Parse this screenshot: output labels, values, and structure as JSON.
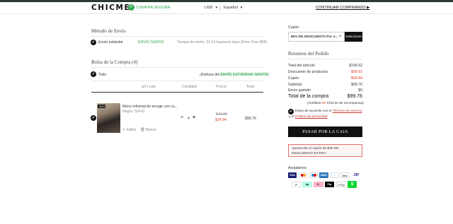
{
  "header": {
    "logo": "CHICME",
    "secure_label": "COMPRA SEGURA",
    "currency": "USD",
    "language": "Español",
    "continue_label": "CONTINUAR COMPRANDO ▶"
  },
  "shipping": {
    "title": "Método de Envío",
    "method": "Envío estándar",
    "price": "ENVÍO GRATIS",
    "time": "Tiempo de envío: 21-61 business days (Free Over $59)"
  },
  "bag": {
    "title": "Bolsa de la Compra (4)",
    "select_all": "Todo",
    "free_shipping_prefix": "¡Disfruta del ",
    "free_shipping_highlight": "ENVÍO ESTÁNDAR GRATIS!",
    "columns": [
      "art í culo",
      "Cantidad",
      "Precio",
      "Total"
    ],
    "item": {
      "image_tag": "-50%",
      "name": "Mono informal de encaje con cu...",
      "variant": "Negro, S(4-6)",
      "quantity": "4",
      "original_price": "$49.88",
      "sale_price": "$24.94",
      "total": "$99.76",
      "edit_label": "Editar",
      "delete_label": "Borrar"
    }
  },
  "coupon": {
    "label": "Cupón",
    "value": "80% DE DESCUENTO Por o...",
    "apply_label": "Seleccione"
  },
  "summary": {
    "title": "Resumen del Pedido",
    "rows": [
      {
        "label": "Total del artículo",
        "value": "$199.52"
      },
      {
        "label": "Descuento de productos",
        "value": "-$99.92"
      },
      {
        "label": "Cupón",
        "value": "-$99.84"
      },
      {
        "label": "Subtotal",
        "value": "$99.76"
      },
      {
        "label": "Envío gratuito",
        "value": "$0"
      }
    ],
    "total_label": "Total de la compra",
    "total_value": "$99.76",
    "credits_prefix": "(Créditos ",
    "credits_value": "99",
    "credits_suffix": " Chicme de recompensa)",
    "terms_prefix": "Estoy de acuerdo con el ",
    "terms_link": "Término de servicio",
    "terms_and": "y el ",
    "privacy_link": "Política de privacidad",
    "pay_label": "PASAR POR LA CAJA",
    "promo_text": "Aproveche el cupón de $30 DE DESCUENTO EXTRA!"
  },
  "payments": {
    "title": "Aceptamos",
    "methods": [
      "VISA",
      "MC",
      "MAESTRO",
      "AMEX",
      "DINERS",
      "DISCOVER",
      "ZIP",
      "PayPal",
      "Afterpay",
      "Klarna",
      "Apple Pay",
      "G Pay",
      "$"
    ],
    "colors": {
      "visa": "#1a1f71",
      "mastercard": "#eb001b",
      "amex": "#2e77bc",
      "afterpay": "#b2fce4",
      "klarna": "#ffb3c7",
      "cashapp": "#00d632"
    }
  }
}
